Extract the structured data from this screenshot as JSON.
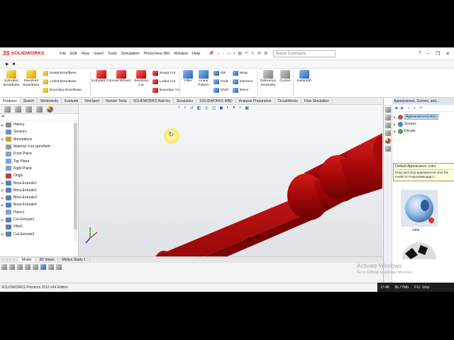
{
  "app": {
    "brand_mark": "3S",
    "brand": "SOLIDWORKS"
  },
  "menu": [
    "File",
    "Edit",
    "View",
    "Insert",
    "Tools",
    "Simulation",
    "PhotoView 360",
    "Window",
    "Help"
  ],
  "search": {
    "placeholder": "Search Commands"
  },
  "command_manager": {
    "buttons": [
      "Extruded Boss/Base",
      "Revolved Boss/Base",
      "Swept Boss/Base",
      "Lofted Boss/Base",
      "Boundary Boss/Base",
      "Extruded Cut",
      "Hole Wizard",
      "Revolved Cut",
      "Swept Cut",
      "Lofted Cut",
      "Boundary Cut",
      "Fillet",
      "Linear Pattern",
      "Rib",
      "Draft",
      "Shell",
      "Wrap",
      "Intersect",
      "Mirror",
      "Reference Geometry",
      "Curves",
      "Instant3D"
    ]
  },
  "tabs": [
    "Features",
    "Sketch",
    "Weldments",
    "Evaluate",
    "DimXpert",
    "Render Tools",
    "SOLIDWORKS Add-Ins",
    "Simulation",
    "SOLIDWORKS MBD",
    "Analysis Preparation",
    "CircuitWorks",
    "Flow Simulation"
  ],
  "feature_tree": [
    {
      "label": "History",
      "icon": "history-icon",
      "color": "#8a8a8a",
      "expandable": true
    },
    {
      "label": "Sensors",
      "icon": "sensor-icon",
      "color": "#6a8fc7",
      "expandable": false
    },
    {
      "label": "Annotations",
      "icon": "annotation-icon",
      "color": "#c9a227",
      "expandable": true
    },
    {
      "label": "Material <not specified>",
      "icon": "material-icon",
      "color": "#9a9a9a",
      "expandable": false
    },
    {
      "label": "Front Plane",
      "icon": "plane-icon",
      "color": "#7ea3d6",
      "expandable": false
    },
    {
      "label": "Top Plane",
      "icon": "plane-icon",
      "color": "#7ea3d6",
      "expandable": false
    },
    {
      "label": "Right Plane",
      "icon": "plane-icon",
      "color": "#7ea3d6",
      "expandable": false
    },
    {
      "label": "Origin",
      "icon": "origin-icon",
      "color": "#b04040",
      "expandable": false
    },
    {
      "label": "Boss-Extrude1",
      "icon": "extrude-icon",
      "color": "#5a7fb5",
      "expandable": true
    },
    {
      "label": "Boss-Extrude2",
      "icon": "extrude-icon",
      "color": "#5a7fb5",
      "expandable": true
    },
    {
      "label": "Boss-Extrude3",
      "icon": "extrude-icon",
      "color": "#5a7fb5",
      "expandable": true
    },
    {
      "label": "Boss-Extrude4",
      "icon": "extrude-icon",
      "color": "#5a7fb5",
      "expandable": true
    },
    {
      "label": "Plane1",
      "icon": "plane-icon",
      "color": "#7ea3d6",
      "expandable": false
    },
    {
      "label": "Cut-Extrude1",
      "icon": "cut-icon",
      "color": "#5a7fb5",
      "expandable": true
    },
    {
      "label": "Fillet1",
      "icon": "fillet-icon",
      "color": "#5a7fb5",
      "expandable": false
    },
    {
      "label": "Cut-Extrude2",
      "icon": "cut-icon",
      "color": "#5a7fb5",
      "expandable": true
    }
  ],
  "bottom_tabs": {
    "nav": "‹ ‹ › ›",
    "tabs": [
      "Model",
      "3D Views",
      "Motion Study 1"
    ]
  },
  "task_pane": {
    "header": "Appearances, Scenes, and...",
    "tree": [
      {
        "label": "Appearances(color)",
        "color": "#d24a3a",
        "selected": true
      },
      {
        "label": "Scenes",
        "color": "#4a7fd0",
        "selected": false
      },
      {
        "label": "Decals",
        "color": "#5a9a4a",
        "selected": false
      }
    ],
    "tooltip": {
      "title": "Default Appearance: color",
      "body": "Drag and drop appearances onto the model or FeatureManager t..."
    },
    "thumb_label": "color"
  },
  "model_color": "#b10a0a",
  "watermark": {
    "title": "Activate Windows",
    "subtitle": "Go to Settings to activate Windows."
  },
  "status": {
    "text": "SOLIDWORKS Premium 2016 x64 Edition"
  },
  "tray": {
    "time": "17:48",
    "speed": "96.77Mb",
    "label": "F11: Stop"
  }
}
